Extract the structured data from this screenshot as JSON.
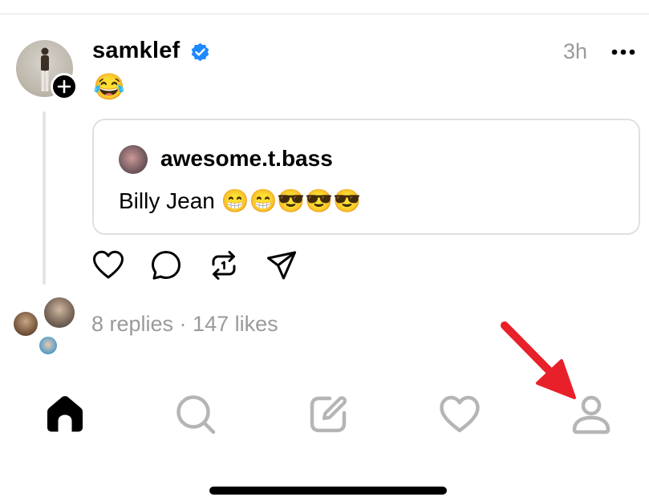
{
  "post": {
    "username": "samklef",
    "time": "3h",
    "body": "😂",
    "avatar_icon": "profile-photo",
    "verified_color": "#1e88ff"
  },
  "quote": {
    "username": "awesome.t.bass",
    "text": "Billy Jean 😁😁😎😎😎"
  },
  "actions": [
    "heart-icon",
    "comment-icon",
    "repost-icon",
    "share-icon"
  ],
  "stats": {
    "text": "8 replies · 147 likes"
  },
  "bottom_nav": [
    "home-icon",
    "search-icon",
    "compose-icon",
    "activity-heart-icon",
    "profile-icon"
  ],
  "annotation": {
    "arrow_color": "#e8202a"
  }
}
